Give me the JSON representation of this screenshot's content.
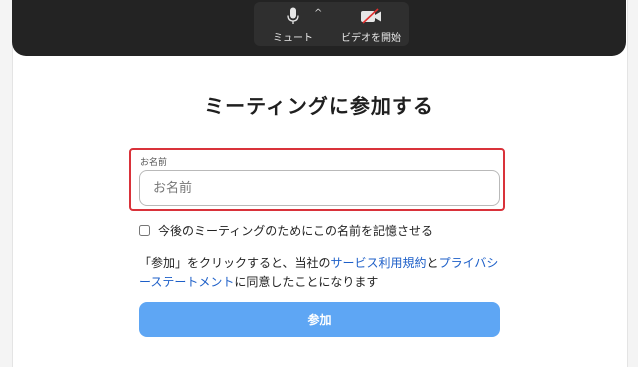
{
  "toolbar": {
    "mute_label": "ミュート",
    "mute_icon": "microphone-icon",
    "caret": "^",
    "video_label": "ビデオを開始",
    "video_icon": "video-off-icon"
  },
  "page_title": "ミーティングに参加する",
  "name_field": {
    "label": "お名前",
    "placeholder": "お名前",
    "value": ""
  },
  "remember": {
    "label": "今後のミーティングのためにこの名前を記憶させる",
    "checked": false
  },
  "terms": {
    "prefix": "「参加」をクリックすると、当社の",
    "link_terms": "サービス利用規約",
    "connector": "と",
    "link_privacy": "プライバシーステートメント",
    "suffix": "に同意したことになります"
  },
  "join_button": {
    "label": "参加"
  },
  "colors": {
    "highlight": "#d9323a",
    "link": "#1d5fc8",
    "button": "#5ea6f4",
    "toolbar_bg": "#232323",
    "video_off_slash": "#e0302f"
  }
}
